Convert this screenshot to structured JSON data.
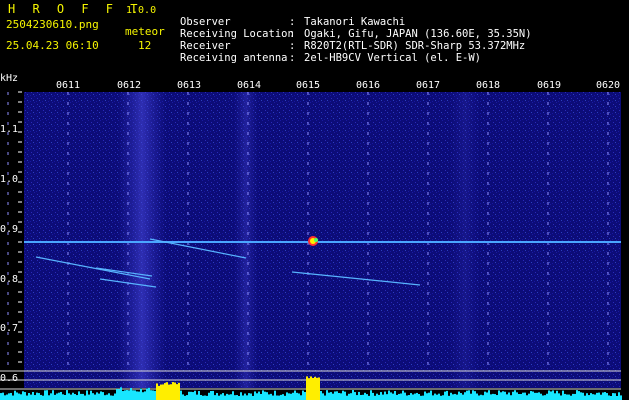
{
  "header": {
    "app_title": "H R O F F T",
    "version": "1.0.0",
    "filename": "2504230610.png",
    "meteor_label": "meteor",
    "datetime": "25.04.23 06:10",
    "meteor_count": "12",
    "rows": [
      {
        "label": "Observer",
        "value": "Takanori Kawachi"
      },
      {
        "label": "Receiving Location",
        "value": "Ogaki, Gifu, JAPAN (136.60E, 35.35N)"
      },
      {
        "label": "Receiver",
        "value": "R820T2(RTL-SDR) SDR-Sharp 53.372MHz"
      },
      {
        "label": "Receiving antenna",
        "value": "2el-HB9CV Vertical (el. E-W)"
      }
    ],
    "separator": ":"
  },
  "spectrogram": {
    "y_unit": "kHz",
    "time_labels": [
      "0611",
      "0612",
      "0613",
      "0614",
      "0615",
      "0616",
      "0617",
      "0618",
      "0619",
      "0620"
    ],
    "freq_labels": [
      "1.1",
      "1.0",
      "0.9",
      "0.8",
      "0.7",
      "0.6"
    ],
    "colors": {
      "background": "#0a0a6e",
      "noise": "#1e1ea8",
      "carrier": "#3aa0ff",
      "level_bar": "#18e6ff",
      "level_peak": "#ffee00",
      "header_title": "#f5f500"
    }
  }
}
